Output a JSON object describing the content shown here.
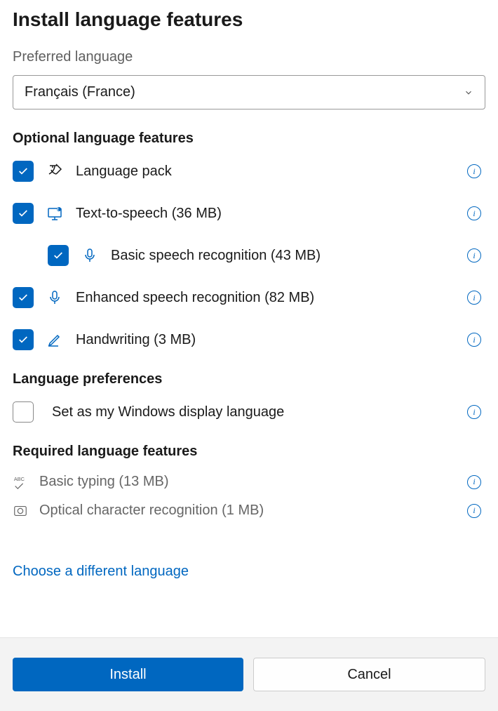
{
  "title": "Install language features",
  "preferred_label": "Preferred language",
  "dropdown_value": "Français (France)",
  "optional_heading": "Optional language features",
  "features": {
    "language_pack": "Language pack",
    "tts": "Text-to-speech (36 MB)",
    "basic_speech": "Basic speech recognition (43 MB)",
    "enhanced_speech": "Enhanced speech recognition (82 MB)",
    "handwriting": "Handwriting (3 MB)"
  },
  "prefs_heading": "Language preferences",
  "prefs": {
    "display_lang": "Set as my Windows display language"
  },
  "required_heading": "Required language features",
  "required": {
    "typing": "Basic typing (13 MB)",
    "ocr": "Optical character recognition (1 MB)"
  },
  "choose_link": "Choose a different language",
  "buttons": {
    "install": "Install",
    "cancel": "Cancel"
  }
}
